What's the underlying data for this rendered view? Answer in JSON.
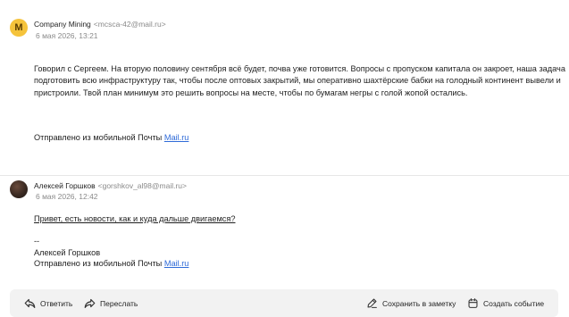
{
  "messages": [
    {
      "avatar_letter": "M",
      "sender_name": "Company Mining",
      "sender_email": "<mcsca-42@mail.ru>",
      "date": "6 мая 2026, 13:21",
      "body": "Говорил с Сергеем. На вторую половину сентября всё будет, почва уже готовится. Вопросы с пропуском капитала он закроет, наша задача подготовить всю инфраструктуру так, чтобы после оптовых закрытий, мы оперативно шахтёрские бабки на голодный континент вывели и пристроили. Твой план минимум это решить вопросы на месте, чтобы по бумагам негры с голой жопой остались.",
      "signature_prefix": "Отправлено из мобильной Почты ",
      "signature_link": "Mail.ru"
    },
    {
      "sender_name": "Алексей Горшков",
      "sender_email": "<gorshkov_al98@mail.ru>",
      "date": "6 мая 2026, 12:42",
      "body_line": "Привет, есть новости, как и куда дальше двигаемся?",
      "dash": "--",
      "signature_name": "Алексей Горшков",
      "signature_prefix": "Отправлено из мобильной Почты ",
      "signature_link": "Mail.ru"
    }
  ],
  "footer": {
    "reply": "Ответить",
    "forward": "Переслать",
    "save_note": "Сохранить в заметку",
    "create_event": "Создать событие"
  },
  "colors": {
    "avatar_m": "#f5c33b",
    "link": "#2f6bd8",
    "footer_bg": "#f2f2f2"
  },
  "icons": [
    "reply-icon",
    "forward-icon",
    "note-icon",
    "calendar-icon"
  ]
}
